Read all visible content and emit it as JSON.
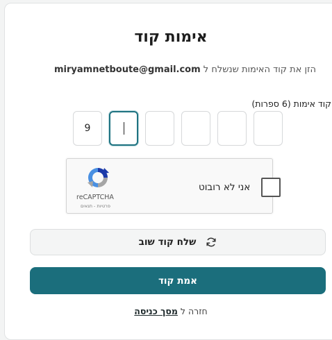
{
  "form": {
    "title": "אימות קוד",
    "subtitle_prefix": "הזן את קוד האימות שנשלח ל ",
    "email": "miryamnetboute@gmail.com",
    "code_label": "קוד אימות (6 ספרות)",
    "code_digits": [
      "9",
      "",
      "",
      "",
      "",
      ""
    ],
    "active_digit_index": 1
  },
  "recaptcha": {
    "label": "אני לא רובוט",
    "brand": "reCAPTCHA",
    "links": "פרטיות - תנאים"
  },
  "actions": {
    "resend_label": "שלח קוד שוב",
    "verify_label": "אמת קוד",
    "back_prefix": "חזרה ל ",
    "back_link": "מסך כניסה"
  },
  "colors": {
    "accent": "#1b6e7c",
    "active_border": "#1f7381"
  },
  "icons": {
    "resend": "refresh-icon",
    "captcha": "recaptcha-logo-icon"
  }
}
